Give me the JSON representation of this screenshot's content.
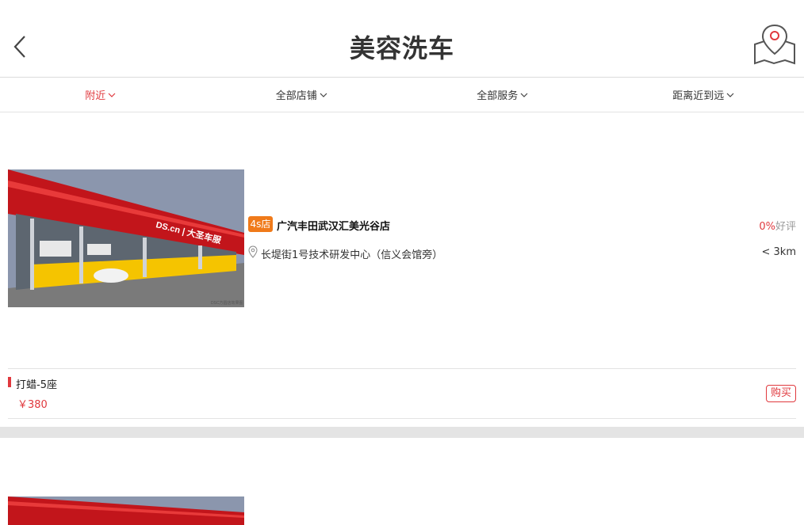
{
  "header": {
    "title": "美容洗车",
    "back_icon": "chevron-left-icon",
    "map_icon": "map-pin-icon"
  },
  "filters": [
    {
      "label": "附近",
      "active": true
    },
    {
      "label": "全部店铺",
      "active": false
    },
    {
      "label": "全部服务",
      "active": false
    },
    {
      "label": "距离近到远",
      "active": false
    }
  ],
  "shops": [
    {
      "badge": "4s店",
      "name": "广汽丰田武汉汇美光谷店",
      "rating_pct": "0%",
      "rating_label": "好评",
      "address": "长堤街1号技术研发中心（信义会馆旁）",
      "distance": "< 3km",
      "storefront_sign": "DS.cn | 大圣车服",
      "image_caption": "DSC方圆店效果图",
      "service": {
        "name": "打蜡-5座",
        "price": "￥380",
        "buy_label": "购买"
      }
    }
  ],
  "colors": {
    "accent": "#e0393e",
    "badge": "#f07a1a"
  }
}
